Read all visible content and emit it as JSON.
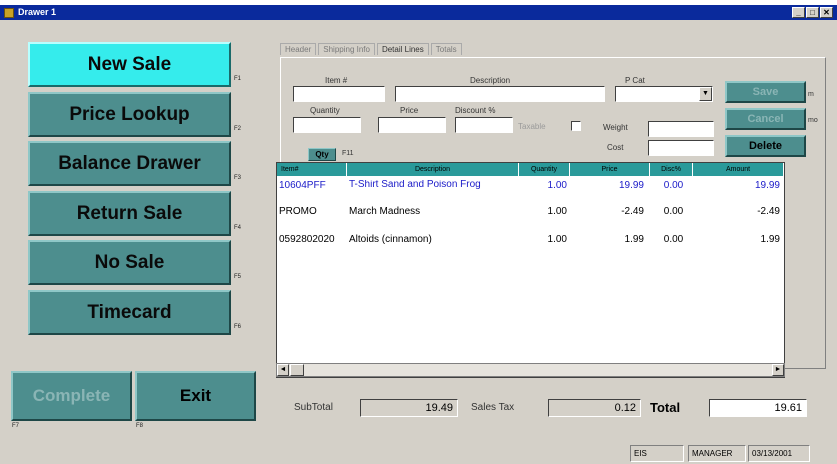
{
  "window": {
    "title": "Drawer 1",
    "min": "_",
    "max": "□",
    "close": "✕"
  },
  "side_buttons": [
    {
      "label": "New Sale",
      "fkey": "F1"
    },
    {
      "label": "Price Lookup",
      "fkey": "F2"
    },
    {
      "label": "Balance Drawer",
      "fkey": "F3"
    },
    {
      "label": "Return Sale",
      "fkey": "F4"
    },
    {
      "label": "No Sale",
      "fkey": "F5"
    },
    {
      "label": "Timecard",
      "fkey": "F6"
    }
  ],
  "bottom": {
    "complete": "Complete",
    "exit": "Exit",
    "complete_fkey": "F7",
    "exit_fkey": "F8"
  },
  "tabs": [
    "Header",
    "Shipping Info",
    "Detail Lines",
    "Totals"
  ],
  "form": {
    "item_label": "Item #",
    "desc_label": "Description",
    "pcat_label": "P Cat",
    "qty_label": "Quantity",
    "price_label": "Price",
    "disc_label": "Discount %",
    "taxable_label": "Taxable",
    "weight_label": "Weight",
    "cost_label": "Cost",
    "qty_button": "Qty",
    "qty_fkey": "F11",
    "save": "Save",
    "cancel": "Cancel",
    "delete": "Delete",
    "save_key": "m",
    "cancel_key": "mo"
  },
  "grid": {
    "headers": [
      "Item#",
      "Description",
      "Quantity",
      "Price",
      "Disc%",
      "Amount"
    ],
    "rows": [
      {
        "item": "10604PFF",
        "desc": "T-Shirt Sand and Poison Frog",
        "qty": "1.00",
        "price": "19.99",
        "disc": "0.00",
        "amount": "19.99",
        "color": "#1a1ac8"
      },
      {
        "item": "PROMO",
        "desc": "March Madness",
        "qty": "1.00",
        "price": "-2.49",
        "disc": "0.00",
        "amount": "-2.49",
        "color": "#000000"
      },
      {
        "item": "0592802020",
        "desc": "Altoids (cinnamon)",
        "qty": "1.00",
        "price": "1.99",
        "disc": "0.00",
        "amount": "1.99",
        "color": "#000000"
      }
    ]
  },
  "totals": {
    "subtotal_label": "SubTotal",
    "subtotal": "19.49",
    "tax_label": "Sales Tax",
    "tax": "0.12",
    "total_label": "Total",
    "total": "19.61"
  },
  "status": {
    "cell1": "EIS",
    "cell2": "MANAGER",
    "cell3": "03/13/2001"
  },
  "colors": {
    "accent": "#4d8e8e",
    "active": "#35ecec",
    "grid_header": "#2a9a9a",
    "title": "#0a2a9c"
  }
}
